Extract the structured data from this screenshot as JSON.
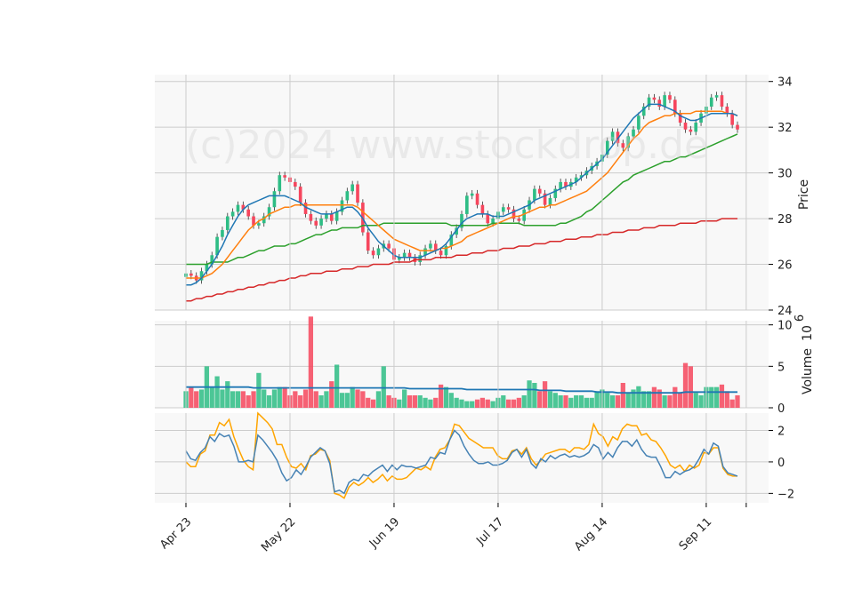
{
  "chart_data": {
    "type": "candlestick",
    "watermark": "(c)2024 www.stockdrop.de",
    "x_tick_labels": [
      "Apr 23",
      "May 22",
      "Jun 19",
      "Jul 17",
      "Aug 14",
      "Sep 11"
    ],
    "colors": {
      "up": "#2ebd85",
      "down": "#f6465d",
      "ma_short": "#1f77b4",
      "ma_mid": "#ff7f0e",
      "ma_long": "#2ca02c",
      "ma_longest": "#d62728",
      "osc_blue": "#4682b4",
      "osc_orange": "#ffa500",
      "grid": "#cccccc",
      "panel_bg": "#f8f8f8"
    },
    "panels": [
      {
        "id": "price",
        "ylabel": "Price",
        "ylim": [
          24,
          34.3
        ],
        "yticks": [
          24,
          26,
          28,
          30,
          32,
          34
        ],
        "close": [
          25.6,
          25.5,
          25.3,
          25.7,
          26.0,
          26.4,
          27.2,
          27.5,
          28.1,
          28.3,
          28.6,
          28.4,
          28.1,
          27.7,
          27.8,
          28.1,
          28.5,
          29.2,
          29.9,
          29.8,
          29.6,
          29.4,
          28.7,
          28.2,
          27.9,
          27.7,
          28.0,
          28.2,
          27.9,
          28.3,
          28.8,
          29.2,
          29.5,
          28.7,
          27.4,
          26.6,
          26.4,
          26.7,
          26.9,
          26.7,
          26.2,
          26.3,
          26.5,
          26.3,
          26.1,
          26.4,
          26.7,
          26.9,
          26.6,
          26.4,
          26.8,
          27.3,
          27.6,
          28.2,
          29.0,
          29.1,
          28.6,
          28.2,
          27.8,
          28.0,
          28.3,
          28.5,
          28.4,
          28.0,
          27.9,
          28.4,
          28.8,
          29.3,
          29.1,
          28.6,
          28.9,
          29.3,
          29.6,
          29.4,
          29.6,
          29.8,
          29.9,
          30.1,
          30.3,
          30.5,
          30.8,
          31.4,
          31.8,
          31.3,
          31.1,
          31.6,
          31.9,
          32.5,
          32.9,
          33.3,
          33.2,
          32.9,
          33.4,
          33.2,
          32.6,
          32.2,
          31.9,
          31.8,
          32.2,
          32.6,
          32.9,
          33.3,
          33.4,
          32.9,
          32.6,
          32.1,
          31.9
        ],
        "ma_short": [
          25.1,
          25.1,
          25.2,
          25.4,
          25.7,
          26.0,
          26.4,
          26.8,
          27.3,
          27.7,
          28.1,
          28.4,
          28.6,
          28.7,
          28.8,
          28.9,
          29.0,
          29.0,
          29.0,
          29.0,
          28.9,
          28.8,
          28.7,
          28.5,
          28.4,
          28.3,
          28.2,
          28.2,
          28.2,
          28.3,
          28.4,
          28.5,
          28.5,
          28.3,
          28.0,
          27.6,
          27.3,
          27.0,
          26.8,
          26.6,
          26.4,
          26.3,
          26.3,
          26.3,
          26.3,
          26.3,
          26.4,
          26.5,
          26.6,
          26.7,
          26.9,
          27.2,
          27.5,
          27.8,
          28.0,
          28.1,
          28.2,
          28.2,
          28.2,
          28.1,
          28.1,
          28.1,
          28.2,
          28.3,
          28.4,
          28.5,
          28.6,
          28.8,
          28.9,
          29.0,
          29.1,
          29.2,
          29.3,
          29.4,
          29.5,
          29.6,
          29.8,
          30.0,
          30.2,
          30.4,
          30.6,
          30.9,
          31.2,
          31.5,
          31.8,
          32.1,
          32.4,
          32.6,
          32.8,
          33.0,
          33.0,
          33.0,
          32.9,
          32.8,
          32.7,
          32.5,
          32.4,
          32.3,
          32.3,
          32.4,
          32.5,
          32.6,
          32.6,
          32.6,
          32.6,
          32.6,
          32.5
        ],
        "ma_mid": [
          25.4,
          25.4,
          25.4,
          25.4,
          25.5,
          25.6,
          25.8,
          26.0,
          26.3,
          26.6,
          26.9,
          27.2,
          27.5,
          27.7,
          27.9,
          28.0,
          28.2,
          28.3,
          28.4,
          28.5,
          28.5,
          28.6,
          28.6,
          28.6,
          28.6,
          28.6,
          28.6,
          28.6,
          28.6,
          28.6,
          28.6,
          28.6,
          28.6,
          28.5,
          28.3,
          28.1,
          27.9,
          27.7,
          27.5,
          27.3,
          27.1,
          27.0,
          26.9,
          26.8,
          26.7,
          26.6,
          26.6,
          26.6,
          26.6,
          26.7,
          26.7,
          26.8,
          26.9,
          27.0,
          27.2,
          27.3,
          27.4,
          27.5,
          27.6,
          27.7,
          27.8,
          27.9,
          28.0,
          28.1,
          28.1,
          28.2,
          28.3,
          28.4,
          28.5,
          28.5,
          28.6,
          28.6,
          28.7,
          28.8,
          28.9,
          29.0,
          29.1,
          29.2,
          29.4,
          29.6,
          29.8,
          30.0,
          30.3,
          30.6,
          30.9,
          31.2,
          31.5,
          31.7,
          32.0,
          32.2,
          32.3,
          32.4,
          32.5,
          32.5,
          32.6,
          32.6,
          32.6,
          32.6,
          32.7,
          32.7,
          32.7,
          32.7,
          32.7,
          32.7,
          32.6,
          32.6,
          32.5
        ],
        "ma_long": [
          26.0,
          26.0,
          26.0,
          26.0,
          26.0,
          26.1,
          26.1,
          26.1,
          26.1,
          26.2,
          26.3,
          26.3,
          26.4,
          26.5,
          26.6,
          26.6,
          26.7,
          26.8,
          26.8,
          26.8,
          26.9,
          26.9,
          27.0,
          27.1,
          27.2,
          27.3,
          27.3,
          27.4,
          27.5,
          27.5,
          27.6,
          27.6,
          27.6,
          27.6,
          27.7,
          27.7,
          27.7,
          27.7,
          27.8,
          27.8,
          27.8,
          27.8,
          27.8,
          27.8,
          27.8,
          27.8,
          27.8,
          27.8,
          27.8,
          27.8,
          27.8,
          27.7,
          27.7,
          27.7,
          27.7,
          27.7,
          27.7,
          27.7,
          27.7,
          27.8,
          27.8,
          27.8,
          27.8,
          27.8,
          27.8,
          27.7,
          27.7,
          27.7,
          27.7,
          27.7,
          27.7,
          27.7,
          27.8,
          27.8,
          27.9,
          28.0,
          28.1,
          28.3,
          28.4,
          28.6,
          28.8,
          29.0,
          29.2,
          29.4,
          29.6,
          29.7,
          29.9,
          30.0,
          30.1,
          30.2,
          30.3,
          30.4,
          30.5,
          30.5,
          30.6,
          30.7,
          30.7,
          30.8,
          30.9,
          31.0,
          31.1,
          31.2,
          31.3,
          31.4,
          31.5,
          31.6,
          31.7
        ],
        "ma_longest": [
          24.4,
          24.4,
          24.5,
          24.5,
          24.6,
          24.6,
          24.7,
          24.7,
          24.8,
          24.8,
          24.9,
          24.9,
          25.0,
          25.0,
          25.1,
          25.1,
          25.2,
          25.2,
          25.3,
          25.3,
          25.4,
          25.4,
          25.5,
          25.5,
          25.6,
          25.6,
          25.6,
          25.7,
          25.7,
          25.7,
          25.8,
          25.8,
          25.8,
          25.9,
          25.9,
          25.9,
          26.0,
          26.0,
          26.0,
          26.0,
          26.1,
          26.1,
          26.1,
          26.1,
          26.2,
          26.2,
          26.2,
          26.2,
          26.3,
          26.3,
          26.3,
          26.3,
          26.4,
          26.4,
          26.4,
          26.5,
          26.5,
          26.5,
          26.6,
          26.6,
          26.6,
          26.7,
          26.7,
          26.7,
          26.8,
          26.8,
          26.8,
          26.9,
          26.9,
          26.9,
          27.0,
          27.0,
          27.0,
          27.1,
          27.1,
          27.1,
          27.2,
          27.2,
          27.2,
          27.3,
          27.3,
          27.3,
          27.4,
          27.4,
          27.4,
          27.5,
          27.5,
          27.5,
          27.6,
          27.6,
          27.6,
          27.7,
          27.7,
          27.7,
          27.7,
          27.8,
          27.8,
          27.8,
          27.8,
          27.9,
          27.9,
          27.9,
          27.9,
          28.0,
          28.0,
          28.0,
          28.0
        ]
      },
      {
        "id": "volume",
        "ylabel": "Volume",
        "ylabel_multiplier": "10^6",
        "ylim": [
          0,
          10.5
        ],
        "yticks": [
          0,
          5,
          10
        ],
        "values": [
          2.0,
          2.5,
          2.0,
          2.2,
          5.0,
          2.5,
          3.8,
          2.2,
          3.2,
          2.0,
          2.0,
          2.0,
          1.5,
          2.0,
          4.2,
          2.2,
          1.5,
          2.2,
          2.5,
          2.5,
          1.5,
          2.0,
          1.5,
          2.2,
          11.0,
          2.0,
          1.5,
          2.0,
          3.2,
          5.2,
          1.8,
          1.8,
          2.5,
          2.2,
          2.0,
          1.2,
          1.0,
          2.0,
          5.0,
          1.5,
          1.2,
          1.0,
          2.2,
          1.5,
          1.5,
          1.5,
          1.2,
          1.0,
          1.2,
          2.8,
          2.5,
          1.8,
          1.2,
          1.0,
          0.8,
          0.8,
          1.0,
          1.2,
          1.0,
          0.8,
          1.2,
          1.5,
          1.0,
          1.0,
          1.2,
          1.5,
          3.3,
          3.0,
          2.0,
          3.2,
          2.0,
          1.8,
          1.5,
          1.5,
          1.2,
          1.5,
          1.5,
          1.2,
          1.2,
          2.0,
          2.2,
          1.8,
          1.5,
          1.5,
          3.0,
          1.8,
          2.2,
          2.6,
          2.0,
          2.0,
          2.5,
          2.2,
          1.5,
          1.5,
          2.5,
          1.8,
          5.4,
          5.0,
          1.8,
          1.5,
          2.5,
          2.5,
          2.5,
          2.8,
          2.0,
          1.0,
          1.5
        ],
        "volume_ma": [
          2.5,
          2.5,
          2.5,
          2.5,
          2.5,
          2.5,
          2.5,
          2.5,
          2.5,
          2.5,
          2.5,
          2.5,
          2.5,
          2.4,
          2.4,
          2.4,
          2.4,
          2.4,
          2.4,
          2.4,
          2.4,
          2.4,
          2.4,
          2.4,
          2.4,
          2.4,
          2.4,
          2.4,
          2.4,
          2.4,
          2.4,
          2.4,
          2.4,
          2.4,
          2.4,
          2.4,
          2.4,
          2.4,
          2.4,
          2.4,
          2.4,
          2.4,
          2.4,
          2.3,
          2.3,
          2.3,
          2.3,
          2.3,
          2.3,
          2.3,
          2.3,
          2.3,
          2.3,
          2.3,
          2.2,
          2.2,
          2.2,
          2.2,
          2.2,
          2.2,
          2.2,
          2.2,
          2.2,
          2.2,
          2.2,
          2.2,
          2.2,
          2.2,
          2.1,
          2.1,
          2.1,
          2.1,
          2.1,
          2.0,
          2.0,
          2.0,
          2.0,
          2.0,
          2.0,
          1.9,
          1.9,
          1.9,
          1.9,
          1.8,
          1.8,
          1.8,
          1.8,
          1.8,
          1.8,
          1.8,
          1.8,
          1.8,
          1.8,
          1.8,
          1.8,
          1.8,
          1.9,
          1.9,
          1.9,
          1.9,
          1.9,
          1.9,
          1.9,
          1.9,
          1.9,
          1.9,
          1.9
        ]
      },
      {
        "id": "oscillator",
        "ylim": [
          -2.6,
          3.1
        ],
        "yticks": [
          -2,
          0,
          2
        ],
        "blue": [
          0.7,
          0.2,
          0.1,
          0.6,
          0.9,
          1.6,
          1.3,
          1.8,
          1.6,
          1.7,
          1.0,
          0.0,
          0.0,
          0.1,
          0.0,
          1.7,
          1.4,
          1.0,
          0.6,
          0.1,
          -0.7,
          -1.2,
          -1.0,
          -0.5,
          -0.8,
          -0.3,
          0.3,
          0.6,
          0.9,
          0.7,
          -0.1,
          -1.9,
          -1.8,
          -2.0,
          -1.3,
          -1.1,
          -1.2,
          -0.8,
          -0.9,
          -0.6,
          -0.4,
          -0.2,
          -0.6,
          -0.2,
          -0.5,
          -0.2,
          -0.3,
          -0.3,
          -0.4,
          -0.3,
          -0.2,
          0.3,
          0.2,
          0.6,
          0.5,
          1.4,
          2.0,
          1.7,
          1.0,
          0.5,
          0.1,
          -0.1,
          -0.1,
          0.0,
          -0.2,
          -0.2,
          -0.1,
          0.1,
          0.6,
          0.8,
          0.3,
          0.8,
          -0.1,
          -0.4,
          0.2,
          0.0,
          0.4,
          0.2,
          0.4,
          0.5,
          0.3,
          0.4,
          0.3,
          0.4,
          0.6,
          1.1,
          0.9,
          0.2,
          0.6,
          0.3,
          0.9,
          1.3,
          1.3,
          1.0,
          1.4,
          0.8,
          0.4,
          0.3,
          0.3,
          -0.3,
          -1.0,
          -1.0,
          -0.6,
          -0.8,
          -0.6,
          -0.5,
          -0.3,
          0.2,
          0.8,
          0.5,
          1.2,
          1.0,
          -0.3,
          -0.7,
          -0.8,
          -0.9
        ],
        "orange": [
          0.0,
          -0.3,
          -0.3,
          0.5,
          0.7,
          1.7,
          1.7,
          2.5,
          2.3,
          2.7,
          1.6,
          0.8,
          0.1,
          -0.3,
          -0.5,
          3.1,
          2.8,
          2.5,
          2.1,
          1.1,
          1.1,
          0.3,
          -0.3,
          -0.4,
          -0.1,
          -0.5,
          0.4,
          0.5,
          0.8,
          0.7,
          0.1,
          -2.0,
          -2.1,
          -2.3,
          -1.6,
          -1.3,
          -1.5,
          -1.3,
          -1.0,
          -1.3,
          -1.1,
          -0.8,
          -1.2,
          -0.9,
          -1.1,
          -1.1,
          -1.0,
          -0.7,
          -0.4,
          -0.5,
          -0.3,
          -0.5,
          0.3,
          0.8,
          0.9,
          1.4,
          2.4,
          2.3,
          1.9,
          1.5,
          1.3,
          1.1,
          0.9,
          0.9,
          0.9,
          0.4,
          0.2,
          0.2,
          0.7,
          0.8,
          0.5,
          0.9,
          0.2,
          -0.2,
          0.1,
          0.5,
          0.6,
          0.7,
          0.8,
          0.8,
          0.6,
          0.9,
          0.9,
          0.8,
          1.1,
          2.4,
          1.8,
          1.6,
          1.0,
          1.6,
          1.4,
          2.1,
          2.4,
          2.3,
          2.3,
          1.7,
          1.8,
          1.4,
          1.3,
          0.9,
          0.4,
          -0.2,
          -0.4,
          -0.2,
          -0.6,
          -0.2,
          -0.4,
          -0.2,
          0.6,
          0.5,
          0.9,
          0.9,
          -0.4,
          -0.8,
          -0.9,
          -0.9
        ]
      }
    ]
  }
}
